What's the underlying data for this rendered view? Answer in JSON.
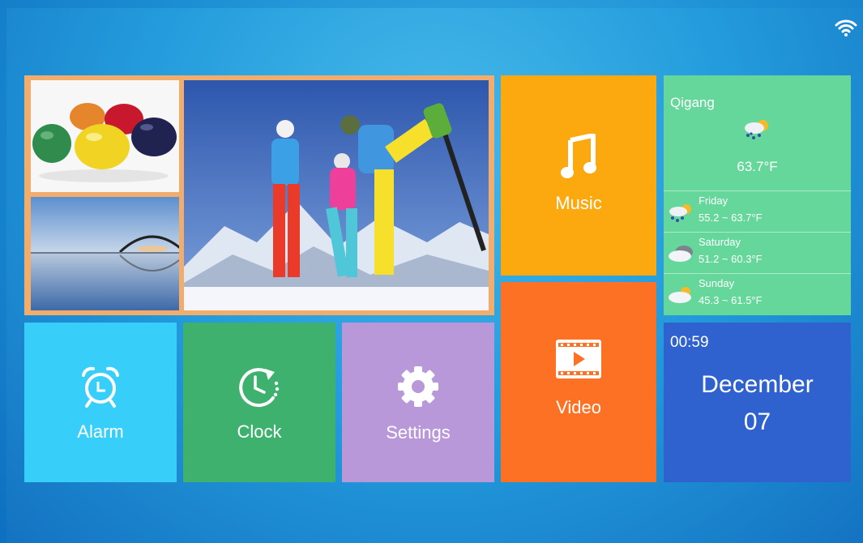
{
  "status_bar": {
    "wifi_icon": "wifi-icon"
  },
  "gallery": {
    "photos": [
      "colorful-eggs-photo",
      "bridge-lake-photo",
      "skiers-photo"
    ],
    "border_color": "#f2ad6d"
  },
  "tiles": {
    "music": {
      "label": "Music",
      "icon": "music-note-icon",
      "color": "#fca910"
    },
    "video": {
      "label": "Video",
      "icon": "film-play-icon",
      "color": "#fd7124"
    },
    "alarm": {
      "label": "Alarm",
      "icon": "alarm-clock-icon",
      "color": "#37cffa"
    },
    "clock": {
      "label": "Clock",
      "icon": "clock-history-icon",
      "color": "#3fb16f"
    },
    "settings": {
      "label": "Settings",
      "icon": "gear-icon",
      "color": "#b998d9"
    }
  },
  "weather": {
    "city": "Qigang",
    "current_temp": "63.7°F",
    "current_icon": "rain-sun-icon",
    "forecast": [
      {
        "day": "Friday",
        "range": "55.2 ~ 63.7°F",
        "icon": "rain-sun-icon"
      },
      {
        "day": "Saturday",
        "range": "51.2 ~ 60.3°F",
        "icon": "cloud-icon"
      },
      {
        "day": "Sunday",
        "range": "45.3 ~ 61.5°F",
        "icon": "sun-cloud-icon"
      }
    ],
    "color": "#66d79a"
  },
  "datetime": {
    "time": "00:59",
    "month": "December",
    "day": "07",
    "color": "#2f61cf"
  }
}
